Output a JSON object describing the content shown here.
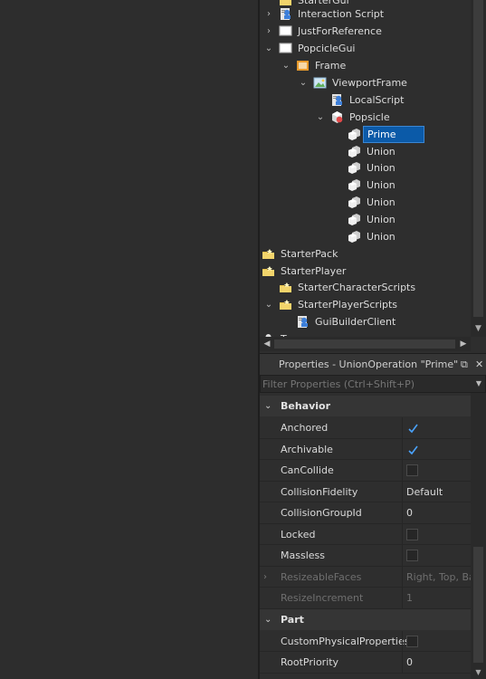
{
  "explorer": {
    "items": [
      {
        "label": "StarterGui",
        "icon": "starter-folder-icon",
        "arrow": ""
      },
      {
        "label": "Interaction Script",
        "icon": "localscript-icon",
        "arrow": "›"
      },
      {
        "label": "JustForReference",
        "icon": "screengui-icon",
        "arrow": "›"
      },
      {
        "label": "PopcicleGui",
        "icon": "screengui-icon",
        "arrow": "⌄"
      },
      {
        "label": "Frame",
        "icon": "frame-icon",
        "arrow": "⌄"
      },
      {
        "label": "ViewportFrame",
        "icon": "viewportframe-icon",
        "arrow": "⌄"
      },
      {
        "label": "LocalScript",
        "icon": "localscript-icon",
        "arrow": ""
      },
      {
        "label": "Popsicle",
        "icon": "model-icon",
        "arrow": "⌄"
      },
      {
        "label": "Prime",
        "icon": "union-icon",
        "arrow": ""
      },
      {
        "label": "Union",
        "icon": "union-icon",
        "arrow": ""
      },
      {
        "label": "Union",
        "icon": "union-icon",
        "arrow": ""
      },
      {
        "label": "Union",
        "icon": "union-icon",
        "arrow": ""
      },
      {
        "label": "Union",
        "icon": "union-icon",
        "arrow": ""
      },
      {
        "label": "Union",
        "icon": "union-icon",
        "arrow": ""
      },
      {
        "label": "Union",
        "icon": "union-icon",
        "arrow": ""
      },
      {
        "label": "StarterPack",
        "icon": "starter-folder-icon",
        "arrow": ""
      },
      {
        "label": "StarterPlayer",
        "icon": "starter-folder-icon",
        "arrow": ""
      },
      {
        "label": "StarterCharacterScripts",
        "icon": "starter-folder-icon",
        "arrow": ""
      },
      {
        "label": "StarterPlayerScripts",
        "icon": "starter-folder-icon",
        "arrow": "⌄"
      },
      {
        "label": "GuiBuilderClient",
        "icon": "localscript-icon",
        "arrow": ""
      },
      {
        "label": "Teams",
        "icon": "teams-icon",
        "arrow": ""
      }
    ]
  },
  "properties": {
    "title": "Properties - UnionOperation \"Prime\"",
    "filter_placeholder": "Filter Properties (Ctrl+Shift+P)",
    "categories": {
      "behavior": "Behavior",
      "part": "Part"
    },
    "rows": {
      "anchored": {
        "name": "Anchored",
        "checked": true
      },
      "archivable": {
        "name": "Archivable",
        "checked": true
      },
      "cancollide": {
        "name": "CanCollide",
        "checked": false
      },
      "collisionfidelity": {
        "name": "CollisionFidelity",
        "value": "Default"
      },
      "collisiongroupid": {
        "name": "CollisionGroupId",
        "value": "0"
      },
      "locked": {
        "name": "Locked",
        "checked": false
      },
      "massless": {
        "name": "Massless",
        "checked": false
      },
      "resizeablefaces": {
        "name": "ResizeableFaces",
        "value": "Right, Top, Back"
      },
      "resizeincrement": {
        "name": "ResizeIncrement",
        "value": "1"
      },
      "customphysical": {
        "name": "CustomPhysicalProperties",
        "checked": false
      },
      "rootpriority": {
        "name": "RootPriority",
        "value": "0"
      }
    }
  },
  "colors": {
    "selection": "#0b5aa8",
    "check": "#4aa3ff"
  }
}
